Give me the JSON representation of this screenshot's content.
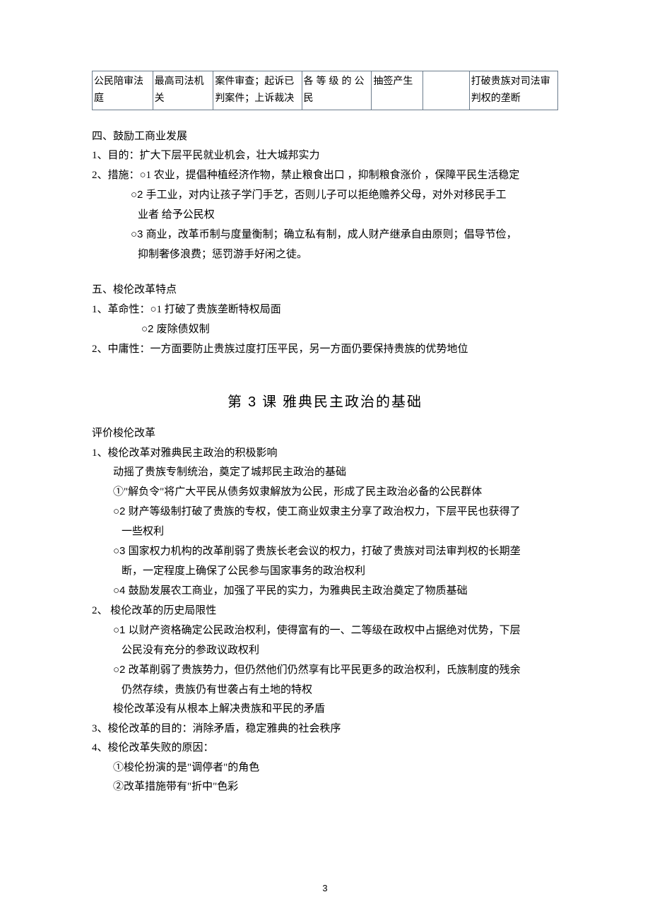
{
  "table": {
    "r0c0": "公民陪审法庭",
    "r0c1": "最高司法机关",
    "r0c2": "案件审查；起诉已判案件；上诉裁决",
    "r0c3": "各等级的公民",
    "r0c4": "抽签产生",
    "r0c5": "",
    "r0c6": "打破贵族对司法审判权的垄断"
  },
  "sec4": {
    "h": "四、鼓励工商业发展",
    "p1": "1、目的：扩大下层平民就业机会，壮大城邦实力",
    "p2": "2、措施：○1 农业，提倡种植经济作物，禁止粮食出口 ，抑制粮食涨价 ，保障平民生活稳定",
    "p2b": "○2 手工业，对内让孩子学门手艺，否则儿子可以拒绝赡养父母，对外对移民手工",
    "p2b2": "业者 给予公民权",
    "p2c": "○3 商业，改革币制与度量衡制；确立私有制，成人财产继承自由原则；倡导节俭，",
    "p2c2": "抑制奢侈浪费；惩罚游手好闲之徒。"
  },
  "sec5": {
    "h": "五、梭伦改革特点",
    "p1": "1、革命性：○1 打破了贵族垄断特权局面",
    "p1b": "○2 废除债奴制",
    "p2": "2、中庸性：一方面要防止贵族过度打压平民，另一方面仍要保持贵族的优势地位"
  },
  "title": {
    "prefix": "第 ",
    "num": "3",
    "suffix": " 课 雅典民主政治的基础"
  },
  "eval": {
    "h": "评价梭伦改革",
    "s1": {
      "h": "1、梭伦改革对雅典民主政治的积极影响",
      "a": "动摇了贵族专制统治，奠定了城邦民主政治的基础",
      "b": "①\"解负令\"将广大平民从债务奴隶解放为公民，形成了民主政治必备的公民群体",
      "c": "○2 财产等级制打破了贵族的专权，使工商业奴隶主分享了政治权力，下层平民也获得了",
      "c2": "一些权利",
      "d": "○3 国家权力机构的改革削弱了贵族长老会议的权力，打破了贵族对司法审判权的长期垄",
      "d2": "断，一定程度上确保了公民参与国家事务的政治权利",
      "e": "○4 鼓励发展农工商业，加强了平民的实力，为雅典民主政治奠定了物质基础"
    },
    "s2": {
      "h": "2、 梭伦改革的历史局限性",
      "a": "○1 以财产资格确定公民政治权利，使得富有的一、二等级在政权中占据绝对优势，下层",
      "a2": "公民没有充分的参政议政权利",
      "b": "○2 改革削弱了贵族势力，但仍然他们仍然享有比平民更多的政治权利，氏族制度的残余",
      "b2": "仍然存续，贵族仍有世袭占有土地的特权",
      "c": "梭伦改革没有从根本上解决贵族和平民的矛盾"
    },
    "s3": "3、梭伦改革的目的：消除矛盾，稳定雅典的社会秩序",
    "s4": {
      "h": "4、梭伦改革失败的原因：",
      "a": "①梭伦扮演的是\"调停者\"的角色",
      "b": "②改革措施带有\"折中\"色彩"
    }
  },
  "pagenum": "3"
}
